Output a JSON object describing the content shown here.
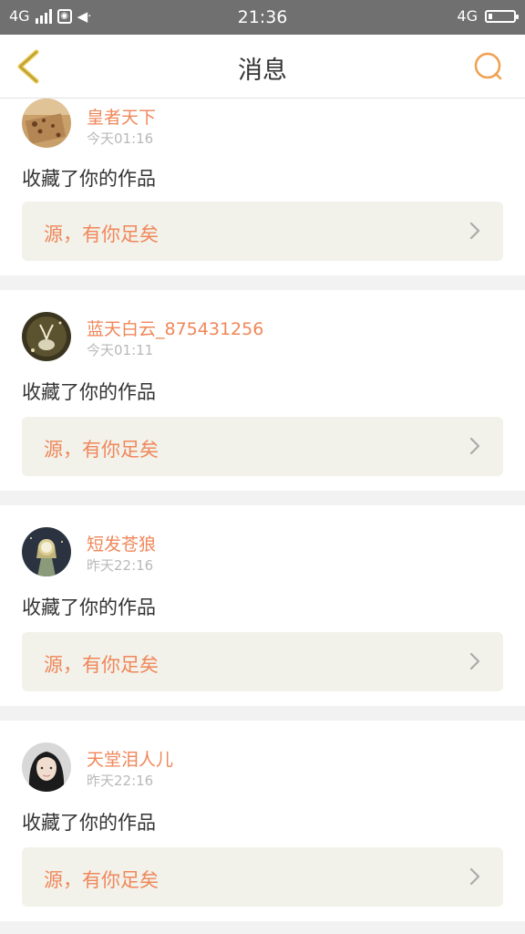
{
  "status_bar": {
    "network_left": "4G",
    "time": "21:36",
    "network_right": "4G"
  },
  "header": {
    "title": "消息",
    "accent_color": "#f0a050"
  },
  "messages": [
    {
      "username": "皇者天下",
      "time": "今天01:16",
      "action": "收藏了你的作品",
      "work_title": "源，有你足矣",
      "avatar": "paper-texture-avatar"
    },
    {
      "username": "蓝天白云_875431256",
      "time": "今天01:11",
      "action": "收藏了你的作品",
      "work_title": "源，有你足矣",
      "avatar": "deer-avatar"
    },
    {
      "username": "短发苍狼",
      "time": "昨天22:16",
      "action": "收藏了你的作品",
      "work_title": "源，有你足矣",
      "avatar": "cartoon-girl-avatar"
    },
    {
      "username": "天堂泪人儿",
      "time": "昨天22:16",
      "action": "收藏了你的作品",
      "work_title": "源，有你足矣",
      "avatar": "portrait-avatar"
    }
  ]
}
